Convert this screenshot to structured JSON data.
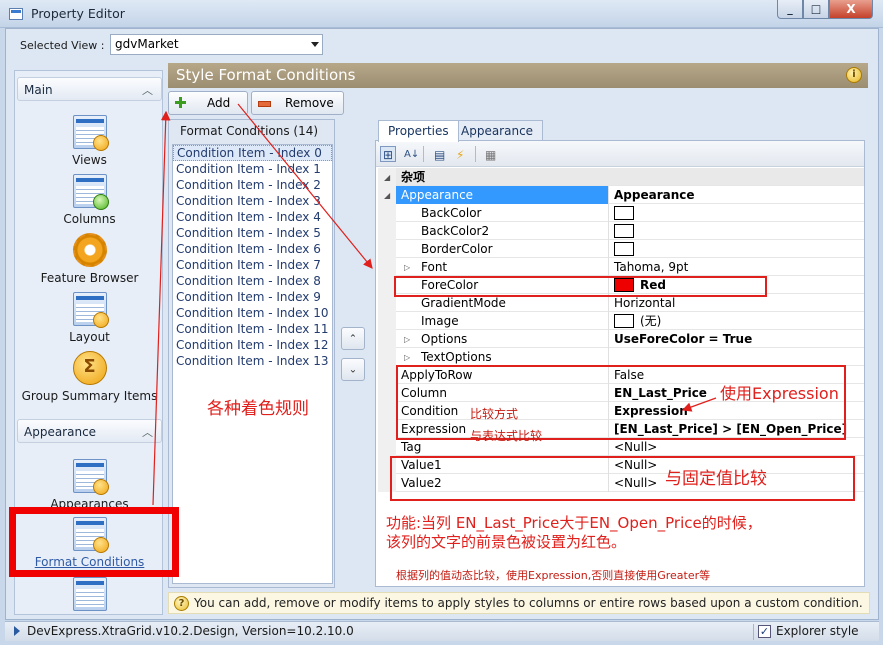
{
  "window": {
    "title": "Property Editor",
    "buttons": {
      "minimize": "_",
      "maximize": "□",
      "close": "X"
    }
  },
  "selected_view": {
    "label": "Selected View :",
    "value": "gdvMarket"
  },
  "nav": {
    "groups": [
      {
        "label": "Main",
        "chevron": "︿"
      },
      {
        "label": "Appearance",
        "chevron": "︿"
      }
    ],
    "items": [
      {
        "label": "Views",
        "icon": "grid-eye-icon"
      },
      {
        "label": "Columns",
        "icon": "grid-add-icon"
      },
      {
        "label": "Feature Browser",
        "icon": "gear-icon"
      },
      {
        "label": "Layout",
        "icon": "grid-layout-icon"
      },
      {
        "label": "Group Summary Items",
        "icon": "sigma-icon"
      },
      {
        "label": "Appearances",
        "icon": "grid-paint-icon"
      },
      {
        "label": "Format Conditions",
        "icon": "grid-format-icon"
      }
    ]
  },
  "panel": {
    "title": "Style Format Conditions",
    "info_glyph": "i"
  },
  "toolbar": {
    "add_label": "Add",
    "remove_label": "Remove"
  },
  "format_conditions": {
    "header": "Format Conditions (14)",
    "items": [
      "Condition Item - Index 0",
      "Condition Item - Index 1",
      "Condition Item - Index 2",
      "Condition Item - Index 3",
      "Condition Item - Index 4",
      "Condition Item - Index 5",
      "Condition Item - Index 6",
      "Condition Item - Index 7",
      "Condition Item - Index 8",
      "Condition Item - Index 9",
      "Condition Item - Index 10",
      "Condition Item - Index 11",
      "Condition Item - Index 12",
      "Condition Item - Index 13"
    ],
    "move_up": "⌃",
    "move_down": "⌄"
  },
  "tabs": [
    "Properties",
    "Appearance"
  ],
  "property_grid": {
    "toolbar_glyphs": [
      "⊞",
      "A↓",
      "▤",
      "⚡",
      "▦"
    ],
    "category": "杂项",
    "rows": [
      {
        "name": "Appearance",
        "value": "Appearance"
      },
      {
        "name": "BackColor",
        "value": ""
      },
      {
        "name": "BackColor2",
        "value": ""
      },
      {
        "name": "BorderColor",
        "value": ""
      },
      {
        "name": "Font",
        "value": "Tahoma, 9pt"
      },
      {
        "name": "ForeColor",
        "value": "Red"
      },
      {
        "name": "GradientMode",
        "value": "Horizontal"
      },
      {
        "name": "Image",
        "value": "(无)"
      },
      {
        "name": "Options",
        "value": "UseForeColor = True"
      },
      {
        "name": "TextOptions",
        "value": ""
      },
      {
        "name": "ApplyToRow",
        "value": "False"
      },
      {
        "name": "Column",
        "value": "EN_Last_Price"
      },
      {
        "name": "Condition",
        "value": "Expression"
      },
      {
        "name": "Expression",
        "value": "[EN_Last_Price] > [EN_Open_Price]"
      },
      {
        "name": "Tag",
        "value": "<Null>"
      },
      {
        "name": "Value1",
        "value": "<Null>"
      },
      {
        "name": "Value2",
        "value": "<Null>"
      }
    ]
  },
  "annotations": {
    "rules": "各种着色规则",
    "use_expression": "使用Expression",
    "compare_mode": "比较方式",
    "compare_expr": "与表达式比较",
    "compare_fixed": "与固定值比较",
    "function_line1": "功能:当列 EN_Last_Price大于EN_Open_Price的时候，",
    "function_line2": "该列的文字的前景色被设置为红色。",
    "note": "根据列的值动态比较，使用Expression,否则直接使用Greater等"
  },
  "hint": {
    "glyph": "?",
    "text": "You can add, remove or modify items to apply styles to columns or entire rows based upon a custom condition."
  },
  "status": {
    "version": "DevExpress.XtraGrid.v10.2.Design, Version=10.2.10.0",
    "explorer_label": "Explorer style",
    "explorer_checked": true
  },
  "colors": {
    "annotation": "#e0201c",
    "selection": "#3399ff",
    "panel_title": "#a89a7c"
  }
}
